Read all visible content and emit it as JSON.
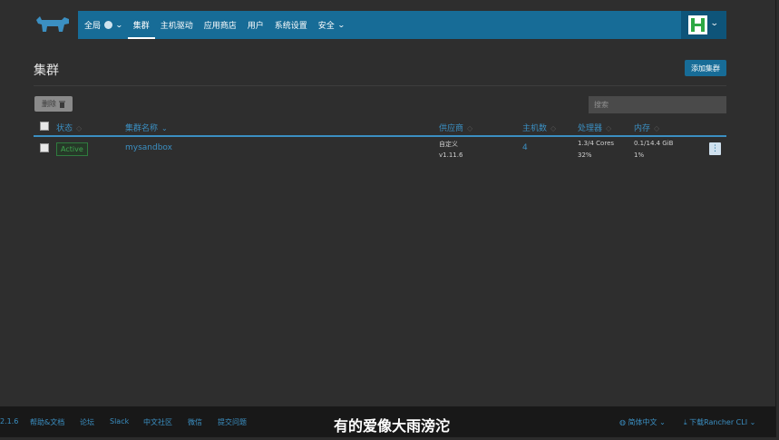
{
  "nav": {
    "global_label": "全局",
    "items": [
      "集群",
      "主机驱动",
      "应用商店",
      "用户",
      "系统设置"
    ],
    "security_label": "安全"
  },
  "page": {
    "title": "集群",
    "add_button": "添加集群",
    "delete_button": "删除",
    "search_placeholder": "搜索"
  },
  "table": {
    "headers": {
      "state": "状态",
      "name": "集群名称",
      "provider": "供应商",
      "nodes": "主机数",
      "cpu": "处理器",
      "memory": "内存"
    },
    "rows": [
      {
        "state": "Active",
        "name": "mysandbox",
        "provider": "自定义",
        "version": "v1.11.6",
        "nodes": "4",
        "cpu": "1.3/4 Cores",
        "cpu_pct": "32%",
        "memory": "0.1/14.4 GiB",
        "memory_pct": "1%"
      }
    ]
  },
  "footer": {
    "version": "2.1.6",
    "links": [
      "帮助&文档",
      "论坛",
      "Slack",
      "中文社区",
      "微信",
      "提交问题"
    ],
    "language": "简体中文",
    "download": "下载Rancher CLI",
    "subtitle": "有的爱像大雨滂沱"
  },
  "colors": {
    "nav_bg": "#176c97",
    "accent": "#3b8fc2",
    "active_green": "#3fa34f",
    "page_bg": "#2e2e2e"
  }
}
